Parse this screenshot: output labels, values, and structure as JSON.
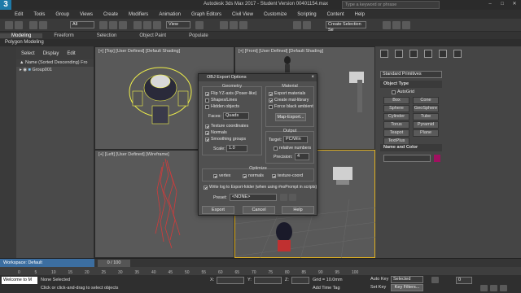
{
  "app": {
    "logo": "3",
    "logo_sub": "MAX",
    "title": "Autodesk 3ds Max 2017 - Student Version    00401154.max",
    "search_placeholder": "Type a keyword or phrase"
  },
  "menu": [
    "Edit",
    "Tools",
    "Group",
    "Views",
    "Create",
    "Modifiers",
    "Animation",
    "Graph Editors",
    "Civil View",
    "Customize",
    "Scripting",
    "Content",
    "Help"
  ],
  "toolbar": {
    "selection_filter": "All",
    "view_dropdown": "View",
    "selection_set": "Create Selection Se"
  },
  "ribbon": {
    "tabs": [
      "Modeling",
      "Freeform",
      "Selection",
      "Object Paint",
      "Populate"
    ],
    "sub": "Polygon Modeling"
  },
  "scene_explorer": {
    "tabs": [
      "Select",
      "Display",
      "Edit"
    ],
    "header": "Name (Sorted Descending)",
    "header_suffix": "Fro",
    "items": [
      "Group001"
    ]
  },
  "viewports": {
    "top_left": "[+] [Top] [User Defined] [Default Shading]",
    "top_right": "[+] [Front] [User Defined] [Default Shading]",
    "bottom_left": "[+] [Left] [User Defined] [Wireframe]",
    "bottom_right": ""
  },
  "dialog": {
    "title": "OBJ Export Options",
    "close": "×",
    "geometry": {
      "title": "Geometry",
      "flip": "Flip YZ-axis (Poser-like)",
      "shapes": "Shapes/Lines",
      "hidden": "Hidden objects",
      "faces_label": "Faces:",
      "faces_value": "Quads",
      "texcoords": "Texture coordinates",
      "normals": "Normals",
      "smoothing": "Smoothing groups",
      "scale_label": "Scale:",
      "scale_value": "1.0"
    },
    "material": {
      "title": "Material",
      "export": "Export materials",
      "create": "Create mat-library",
      "force": "Force black ambient",
      "map_btn": "Map-Export..."
    },
    "output": {
      "title": "Output",
      "target_label": "Target:",
      "target_value": "PC/Win",
      "relative": "relative numbers",
      "precision_label": "Precision:",
      "precision_value": "4"
    },
    "optimize": {
      "title": "Optimize",
      "vertex": "vertex",
      "normals": "normals",
      "texcoord": "texture-coord"
    },
    "log": "Write log to Export-folder (when using #noPrompt in scripts)",
    "preset_label": "Preset:",
    "preset_value": "<NONE>",
    "buttons": {
      "export": "Export",
      "cancel": "Cancel",
      "help": "Help"
    }
  },
  "command_panel": {
    "category": "Standard Primitives",
    "object_type": "Object Type",
    "autogrid": "AutoGrid",
    "buttons": [
      "Box",
      "Cone",
      "Sphere",
      "GeoSphere",
      "Cylinder",
      "Tube",
      "Torus",
      "Pyramid",
      "Teapot",
      "Plane",
      "TextPlus"
    ],
    "name_color": "Name and Color"
  },
  "timeline": {
    "frame": "0 / 100",
    "ticks": [
      "0",
      "5",
      "10",
      "15",
      "20",
      "25",
      "30",
      "35",
      "40",
      "45",
      "50",
      "55",
      "60",
      "65",
      "70",
      "75",
      "80",
      "85",
      "90",
      "95",
      "100"
    ]
  },
  "status": {
    "workspace": "Workspace: Default",
    "maxscript": "Welcome to M",
    "none_selected": "None Selected",
    "hint": "Click or click-and-drag to select objects",
    "x_label": "X:",
    "y_label": "Y:",
    "z_label": "Z:",
    "grid": "Grid = 10.0mm",
    "add_time_tag": "Add Time Tag",
    "auto_key": "Auto Key",
    "selected": "Selected",
    "set_key": "Set Key",
    "key_filters": "Key Filters...",
    "frame_field": "0"
  },
  "colors": {
    "accent": "#1e7aa8",
    "selection": "#f2f24a",
    "wire_red": "#d23b3b",
    "color_swatch": "#a01060"
  }
}
